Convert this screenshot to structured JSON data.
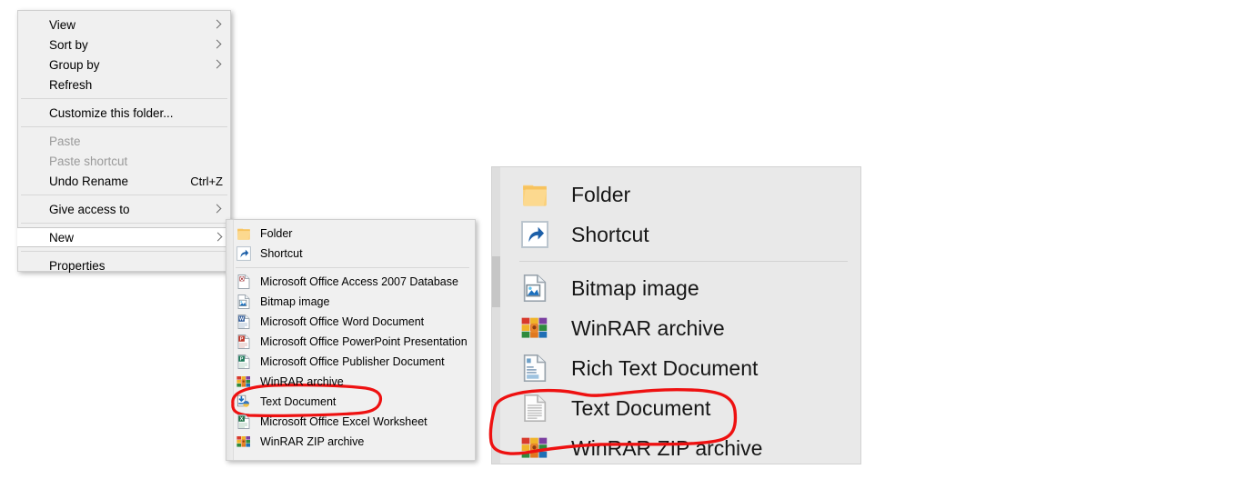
{
  "context_menu": {
    "name": "desktop-folder-context-menu",
    "items": [
      {
        "label": "View",
        "type": "submenu",
        "state": "normal",
        "icon": "chevron-right-icon"
      },
      {
        "label": "Sort by",
        "type": "submenu",
        "state": "normal",
        "icon": "chevron-right-icon"
      },
      {
        "label": "Group by",
        "type": "submenu",
        "state": "normal",
        "icon": "chevron-right-icon"
      },
      {
        "label": "Refresh",
        "type": "command",
        "state": "normal",
        "icon": ""
      },
      {
        "label": "separator-1",
        "type": "separator"
      },
      {
        "label": "Customize this folder...",
        "type": "command",
        "state": "normal",
        "icon": ""
      },
      {
        "label": "separator-2",
        "type": "separator"
      },
      {
        "label": "Paste",
        "type": "command",
        "state": "disabled",
        "icon": ""
      },
      {
        "label": "Paste shortcut",
        "type": "command",
        "state": "disabled",
        "icon": ""
      },
      {
        "label": "Undo Rename",
        "type": "command",
        "state": "normal",
        "icon": "",
        "accelerator": "Ctrl+Z"
      },
      {
        "label": "separator-3",
        "type": "separator"
      },
      {
        "label": "Give access to",
        "type": "submenu",
        "state": "normal",
        "icon": "chevron-right-icon"
      },
      {
        "label": "separator-4",
        "type": "separator"
      },
      {
        "label": "New",
        "type": "submenu",
        "state": "highlighted",
        "icon": "chevron-right-icon"
      },
      {
        "label": "separator-5",
        "type": "separator"
      },
      {
        "label": "Properties",
        "type": "command",
        "state": "normal",
        "icon": ""
      }
    ]
  },
  "new_submenu": {
    "name": "new-submenu",
    "items": [
      {
        "label": "Folder",
        "icon": "folder-icon"
      },
      {
        "label": "Shortcut",
        "icon": "shortcut-icon"
      },
      {
        "label": "separator-1",
        "icon": "separator"
      },
      {
        "label": "Microsoft Office Access 2007 Database",
        "icon": "access-document-icon"
      },
      {
        "label": "Bitmap image",
        "icon": "bitmap-image-icon"
      },
      {
        "label": "Microsoft Office Word Document",
        "icon": "word-document-icon"
      },
      {
        "label": "Microsoft Office PowerPoint Presentation",
        "icon": "powerpoint-document-icon"
      },
      {
        "label": "Microsoft Office Publisher Document",
        "icon": "publisher-document-icon"
      },
      {
        "label": "WinRAR archive",
        "icon": "winrar-archive-icon"
      },
      {
        "label": "Text Document",
        "icon": "text-document-alt-icon"
      },
      {
        "label": "Microsoft Office Excel Worksheet",
        "icon": "excel-document-icon"
      },
      {
        "label": "WinRAR ZIP archive",
        "icon": "winrar-zip-icon"
      }
    ]
  },
  "zoom_panel": {
    "name": "magnified-new-submenu",
    "items": [
      {
        "label": "Folder",
        "icon": "folder-icon"
      },
      {
        "label": "Shortcut",
        "icon": "shortcut-icon"
      },
      {
        "label": "separator-1",
        "icon": "separator"
      },
      {
        "label": "Bitmap image",
        "icon": "bitmap-image-icon"
      },
      {
        "label": "WinRAR archive",
        "icon": "winrar-archive-icon"
      },
      {
        "label": "Rich Text Document",
        "icon": "rich-text-document-icon"
      },
      {
        "label": "Text Document",
        "icon": "text-document-icon"
      },
      {
        "label": "WinRAR ZIP archive",
        "icon": "winrar-zip-icon"
      }
    ]
  },
  "annotations": [
    {
      "name": "red-circle-text-document-small",
      "target": "Text Document",
      "color": "#ee1111",
      "shape": "hand-drawn-ellipse"
    },
    {
      "name": "red-circle-text-document-zoom",
      "target": "Text Document",
      "color": "#ee1111",
      "shape": "hand-drawn-ellipse"
    }
  ],
  "colors": {
    "menu_background": "#f0f0f0",
    "menu_border": "#cfcfcf",
    "panel_background": "#e9e9e9",
    "highlight_background": "#ffffff",
    "disabled_text": "#9a9a9a",
    "annotation_red": "#ee1111"
  }
}
